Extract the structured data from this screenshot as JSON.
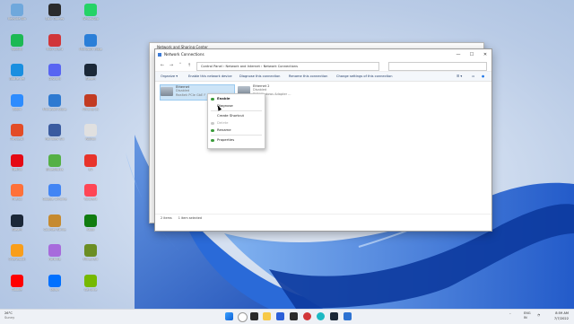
{
  "desktop": {
    "icons": [
      {
        "label": "Recycle Bin",
        "color": "#6fa8dc"
      },
      {
        "label": "Epic Games",
        "color": "#2b2b2b"
      },
      {
        "label": "WhatsApp",
        "color": "#25d366"
      },
      {
        "label": "Spotify",
        "color": "#1db954"
      },
      {
        "label": "Riot Client",
        "color": "#d13639"
      },
      {
        "label": "Microsoft Edge",
        "color": "#2b7fd8"
      },
      {
        "label": "Battle.net",
        "color": "#1a8fe0"
      },
      {
        "label": "Discord",
        "color": "#5865f2"
      },
      {
        "label": "Steam",
        "color": "#1b2838"
      },
      {
        "label": "Zoom",
        "color": "#2d8cff"
      },
      {
        "label": "Microsoft Store",
        "color": "#2e7ad1"
      },
      {
        "label": "Among Us",
        "color": "#c23b22"
      },
      {
        "label": "Anydesk",
        "color": "#e34c26"
      },
      {
        "label": "Rainbow Six",
        "color": "#3a5ba0"
      },
      {
        "label": "Roblox",
        "color": "#e0e0e0"
      },
      {
        "label": "Netflix",
        "color": "#e50914"
      },
      {
        "label": "BlueStacks",
        "color": "#55b045"
      },
      {
        "label": "EA",
        "color": "#e8332b"
      },
      {
        "label": "Firefox",
        "color": "#ff7139"
      },
      {
        "label": "Google Chrome",
        "color": "#4285f4"
      },
      {
        "label": "Valorant",
        "color": "#ff4655"
      },
      {
        "label": "Steam",
        "color": "#1b2838"
      },
      {
        "label": "Counter-Strike",
        "color": "#c68a2f"
      },
      {
        "label": "Xbox",
        "color": "#107c10"
      },
      {
        "label": "Overwatch",
        "color": "#f99e1a"
      },
      {
        "label": "Fortnite",
        "color": "#a76bdc"
      },
      {
        "label": "Minecraft",
        "color": "#6b8e23"
      },
      {
        "label": "Adobe",
        "color": "#ff0000"
      },
      {
        "label": "Uplay",
        "color": "#0070ff"
      },
      {
        "label": "GeForce",
        "color": "#76b900"
      }
    ]
  },
  "back_window": {
    "title": "Network and Sharing Center"
  },
  "window": {
    "title": "Network Connections",
    "controls": {
      "minimize": "—",
      "maximize": "☐",
      "close": "✕"
    },
    "path": "Control Panel  ›  Network and Internet  ›  Network Connections",
    "command_bar": {
      "organize": "Organize ▾",
      "enable": "Enable this network device",
      "diagnose": "Diagnose this connection",
      "rename": "Rename this connection",
      "change": "Change settings of this connection"
    },
    "adapters": [
      {
        "name": "Ethernet",
        "status": "Disabled",
        "device": "Realtek PCIe GbE F"
      },
      {
        "name": "Ethernet 2",
        "status": "Disabled",
        "device": "TAP-Windows Adapter ..."
      }
    ],
    "status_bar": {
      "items": "2 items",
      "selected": "1 item selected"
    }
  },
  "context_menu": {
    "items": [
      {
        "label": "Enable",
        "bold": true,
        "disabled": false
      },
      {
        "label": "Diagnose",
        "bold": false,
        "disabled": false
      },
      {
        "label": "Create Shortcut",
        "bold": false,
        "disabled": false
      },
      {
        "label": "Delete",
        "bold": false,
        "disabled": true
      },
      {
        "label": "Rename",
        "bold": false,
        "disabled": false
      },
      {
        "label": "Properties",
        "bold": false,
        "disabled": false
      }
    ]
  },
  "taskbar": {
    "weather_temp": "26°C",
    "weather_text": "Sunny",
    "lang": "ENG",
    "region": "IN",
    "time": "8:59 AM",
    "date": "7/7/2022"
  }
}
